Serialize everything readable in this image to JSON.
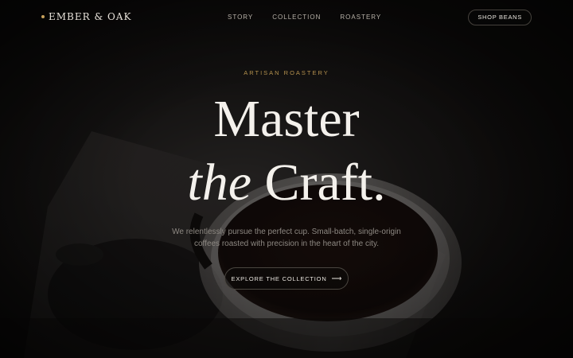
{
  "brand": {
    "name": "EMBER & OAK"
  },
  "nav": {
    "items": [
      "STORY",
      "COLLECTION",
      "ROASTERY"
    ],
    "cta_label": "SHOP BEANS"
  },
  "hero": {
    "eyebrow": "ARTISAN ROASTERY",
    "headline_line1": "Master",
    "headline_italic": "the",
    "headline_rest": " Craft.",
    "subtitle_line1": "We relentlessly pursue the perfect cup. Small-batch, single-origin",
    "subtitle_line2": "coffees roasted with precision in the heart of the city.",
    "cta_label": "EXPLORE THE COLLECTION",
    "cta_icon": "arrow-right-icon"
  },
  "colors": {
    "accent": "#c8a25c",
    "background": "#0d0c0b",
    "headline": "#f4f1ec"
  }
}
